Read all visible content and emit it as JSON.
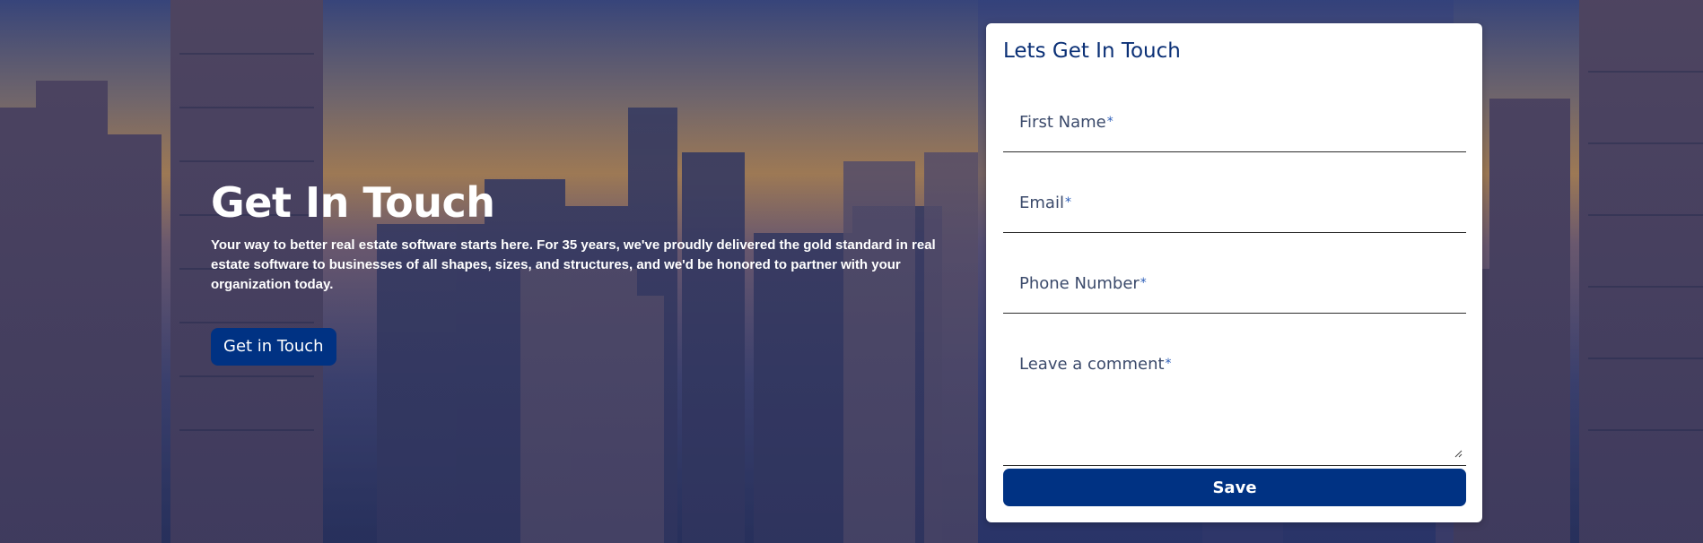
{
  "hero": {
    "title": "Get In Touch",
    "description": "Your way to better real estate software starts here. For 35 years, we've proudly delivered the gold standard in real estate software to businesses of all shapes, sizes, and structures, and we'd be honored to partner with your organization today.",
    "button_label": "Get in Touch"
  },
  "form": {
    "title": "Lets Get In Touch",
    "fields": [
      {
        "label": "First Name",
        "required_mark": "*",
        "value": ""
      },
      {
        "label": "Email",
        "required_mark": "*",
        "value": ""
      },
      {
        "label": "Phone Number",
        "required_mark": "*",
        "value": ""
      },
      {
        "label": "Leave a comment",
        "required_mark": "*",
        "value": ""
      }
    ],
    "submit_label": "Save"
  },
  "colors": {
    "brand_blue": "#003283",
    "title_blue": "#0b3076",
    "required_star": "#2b5db8",
    "card_background": "#ffffff"
  }
}
